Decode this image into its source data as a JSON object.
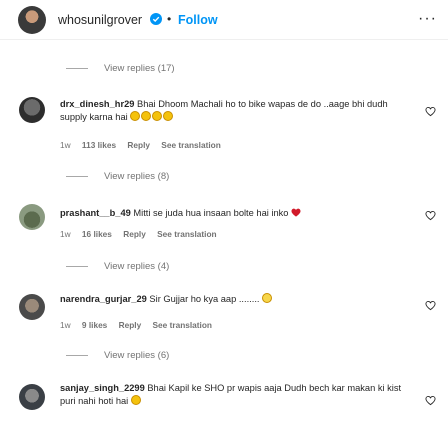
{
  "header": {
    "username": "whosunilgrover",
    "dot": "•",
    "follow_label": "Follow",
    "more": "···"
  },
  "threads": [
    {
      "replies": "View replies (17)"
    },
    {
      "username": "drx_dinesh_hr29",
      "text": "Bhai Dhoom Machali ho to bike wapas de do ..aage bhi dudh supply karna hai",
      "emoji_count": 4,
      "time": "1w",
      "likes": "113 likes",
      "reply": "Reply",
      "translate": "See translation",
      "replies": "View replies (8)"
    },
    {
      "username": "prashant__b_49",
      "text": "Mitti se juda hua insaan bolte hai inko",
      "time": "1w",
      "likes": "16 likes",
      "reply": "Reply",
      "translate": "See translation",
      "replies": "View replies (4)"
    },
    {
      "username": "narendra_gurjar_29",
      "text": "Sir Gujjar ho kya aap ........",
      "time": "1w",
      "likes": "9 likes",
      "reply": "Reply",
      "translate": "See translation",
      "replies": "View replies (6)"
    },
    {
      "username": "sanjay_singh_2299",
      "text": "Bhai Kapil ke SHO pr wapis aaja Dudh bech kar makan ki kist puri nahi hoti hai"
    }
  ]
}
